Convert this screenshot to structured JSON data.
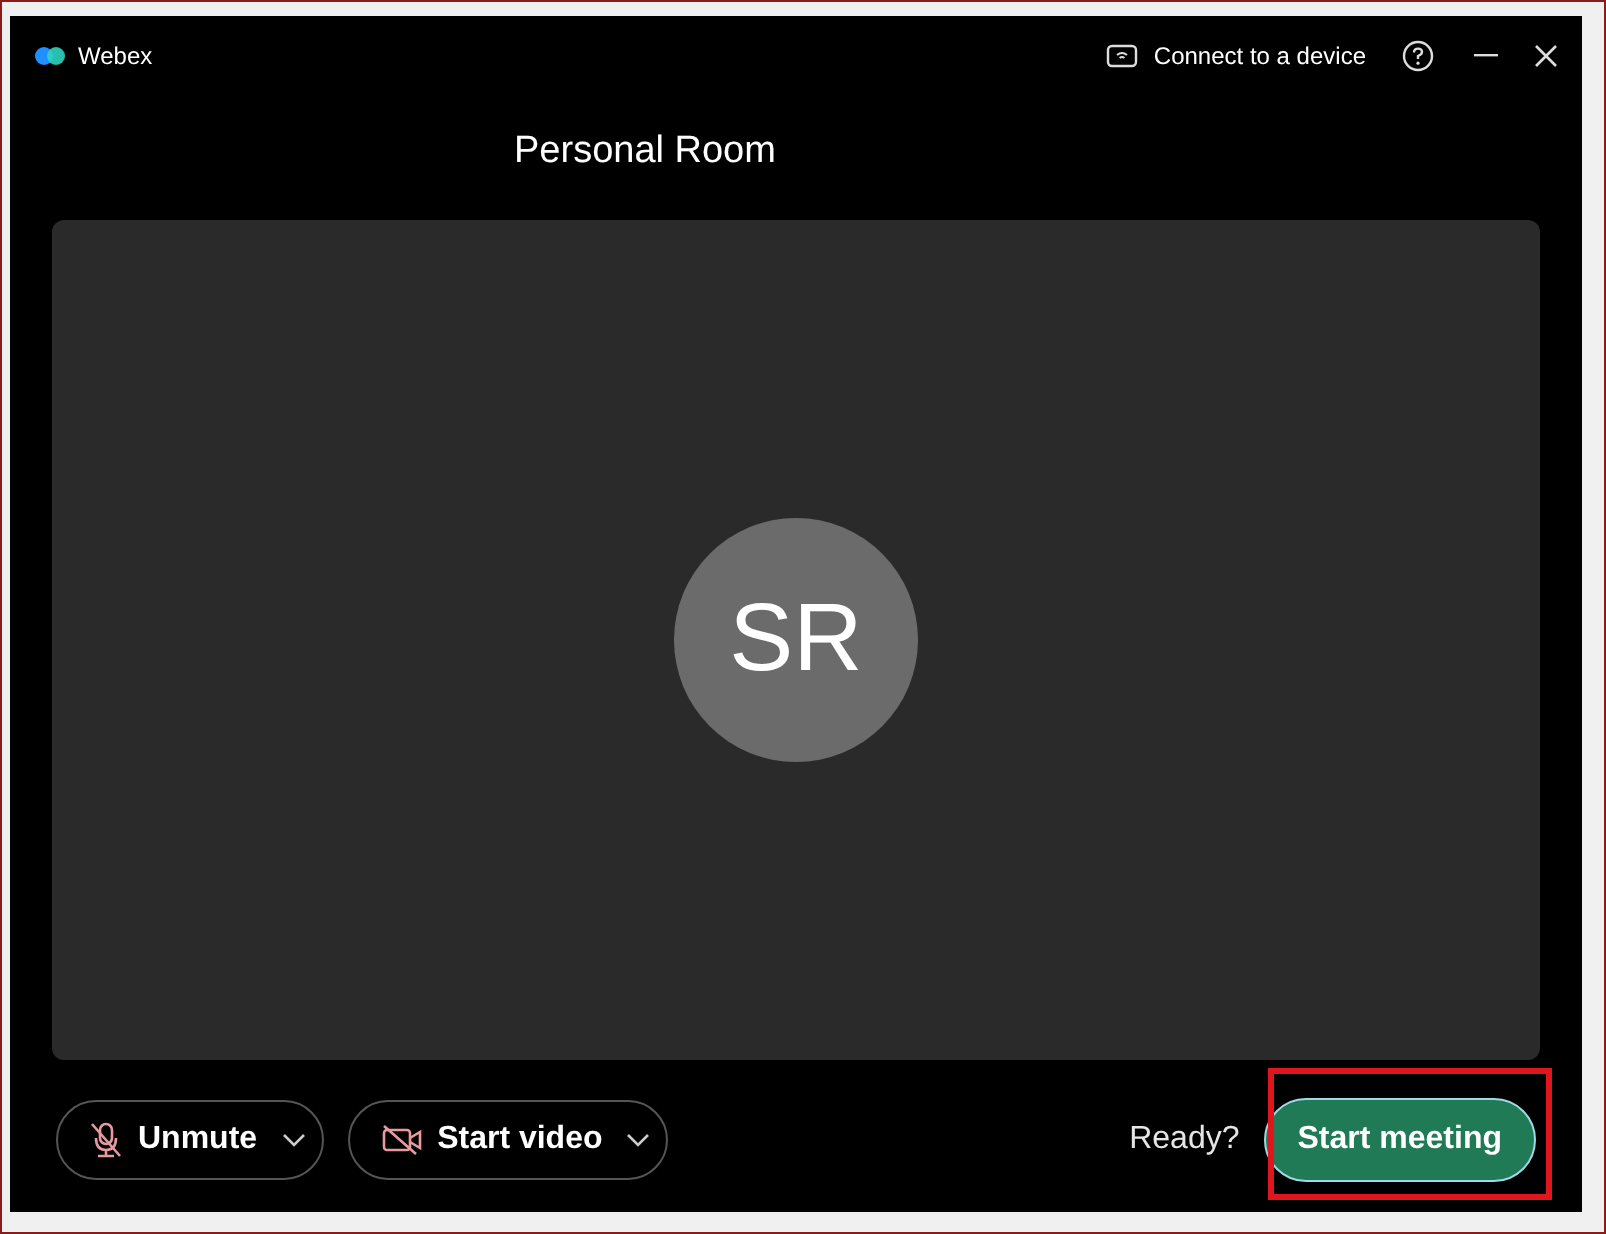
{
  "window": {
    "title": "Webex"
  },
  "header": {
    "connect": "Connect to a device"
  },
  "room": {
    "title": "Personal Room",
    "avatar_initials": "SR"
  },
  "controls": [
    {
      "kind": "audio",
      "label": "Unmute"
    },
    {
      "kind": "video",
      "label": "Start video"
    }
  ],
  "ready_text": "Ready?",
  "start_button": "Start meeting"
}
